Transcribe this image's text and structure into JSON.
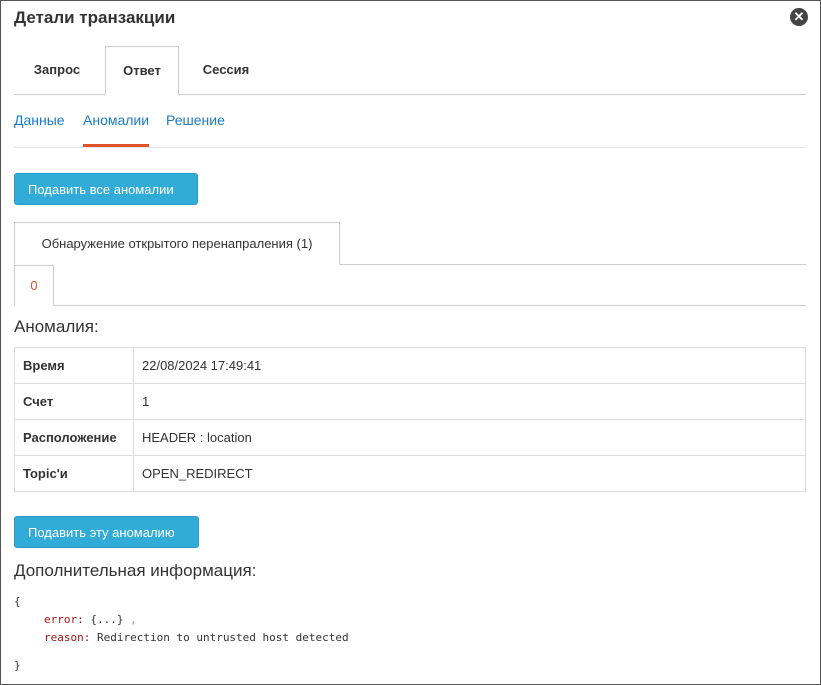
{
  "window": {
    "title": "Детали транзакции",
    "close_glyph": "✕"
  },
  "main_tabs": [
    {
      "label": "Запрос",
      "active": false
    },
    {
      "label": "Ответ",
      "active": true
    },
    {
      "label": "Сессия",
      "active": false
    }
  ],
  "sub_tabs": [
    {
      "label": "Данные",
      "active": false
    },
    {
      "label": "Аномалии",
      "active": true
    },
    {
      "label": "Решение",
      "active": false
    }
  ],
  "colors": {
    "accent": "#e0532a",
    "button": "#31abd7",
    "link": "#1a7bc8"
  },
  "suppress_all_label": "Подавить все аномалии",
  "detection_tab_label": "Обнаружение открытого перенапраления (1)",
  "index_tab_label": "0",
  "anomaly_heading": "Аномалия:",
  "anomaly_table": [
    {
      "key": "Время",
      "value": "22/08/2024 17:49:41"
    },
    {
      "key": "Счет",
      "value": "1"
    },
    {
      "key": "Расположение",
      "value": "HEADER : location"
    },
    {
      "key": "Topic'и",
      "value": "OPEN_REDIRECT"
    }
  ],
  "suppress_one_label": "Подавить эту аномалию",
  "additional_heading": "Дополнительная информация:",
  "details": {
    "open_brace": "{",
    "error_key": "error:",
    "error_value": "{...}",
    "error_sep": ",",
    "reason_key": "reason:",
    "reason_value": "Redirection to untrusted host detected",
    "close_brace": "}"
  }
}
